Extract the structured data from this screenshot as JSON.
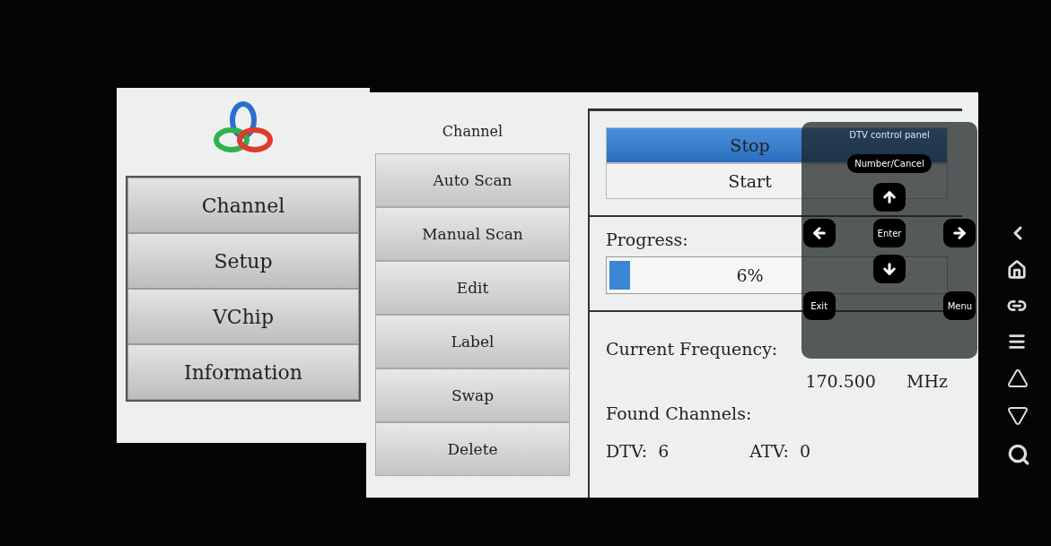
{
  "main_menu": [
    {
      "label": "Channel"
    },
    {
      "label": "Setup"
    },
    {
      "label": "VChip"
    },
    {
      "label": "Information"
    }
  ],
  "sub_menu": {
    "title": "Channel",
    "items": [
      {
        "label": "Auto Scan"
      },
      {
        "label": "Manual Scan"
      },
      {
        "label": "Edit"
      },
      {
        "label": "Label"
      },
      {
        "label": "Swap"
      },
      {
        "label": "Delete"
      }
    ]
  },
  "scan": {
    "actions": [
      {
        "label": "Stop",
        "selected": true
      },
      {
        "label": "Start",
        "selected": false
      }
    ],
    "progress_label": "Progress:",
    "progress": {
      "level": 0.06,
      "reading": "6%"
    },
    "frequency_label": "Current Frequency:",
    "frequency": "170.500",
    "frequency_unit": "MHz",
    "found_label": "Found Channels:",
    "counts": [
      {
        "label": "DTV:",
        "value": "6"
      },
      {
        "label": "ATV:",
        "value": "0"
      }
    ]
  },
  "control_panel": {
    "title": "DTV control panel",
    "number_button": "Number/Cancel",
    "enter_button": "Enter",
    "exit_button": "Exit",
    "menu_button": "Menu"
  }
}
